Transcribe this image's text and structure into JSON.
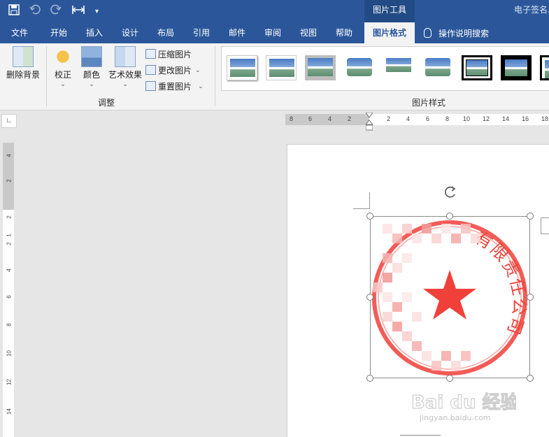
{
  "title_bar": {
    "context_tab_group": "图片工具",
    "document_title": "电子签名."
  },
  "tabs": [
    {
      "label": "文件"
    },
    {
      "label": "开始"
    },
    {
      "label": "插入"
    },
    {
      "label": "设计"
    },
    {
      "label": "布局"
    },
    {
      "label": "引用"
    },
    {
      "label": "邮件"
    },
    {
      "label": "审阅"
    },
    {
      "label": "视图"
    },
    {
      "label": "帮助"
    },
    {
      "label": "图片格式",
      "active": true
    }
  ],
  "tell_me": {
    "label": "操作说明搜索",
    "icon": "lightbulb-icon"
  },
  "ribbon": {
    "remove_background": "删除背景",
    "corrections": "校正",
    "color": "颜色",
    "artistic_effects": "艺术效果",
    "compress_pictures": "压缩图片",
    "change_picture": "更改图片",
    "reset_picture": "重置图片",
    "adjust_group": "调整",
    "picture_styles_group": "图片样式"
  },
  "horizontal_ruler": [
    "8",
    "6",
    "4",
    "2",
    "2",
    "4",
    "6",
    "8",
    "10",
    "12",
    "14",
    "16",
    "18"
  ],
  "vertical_ruler": [
    "4",
    "2",
    "2",
    "1",
    "2",
    "4",
    "6",
    "8",
    "10",
    "12",
    "14"
  ],
  "seal": {
    "arc_text": "有限责任公司",
    "color": "#f0403a"
  },
  "watermark": {
    "brand": "Bai du 经验",
    "url": "jingyan.baidu.com"
  },
  "colors": {
    "title_bar": "#2b579a",
    "ribbon": "#f3f3f3"
  }
}
